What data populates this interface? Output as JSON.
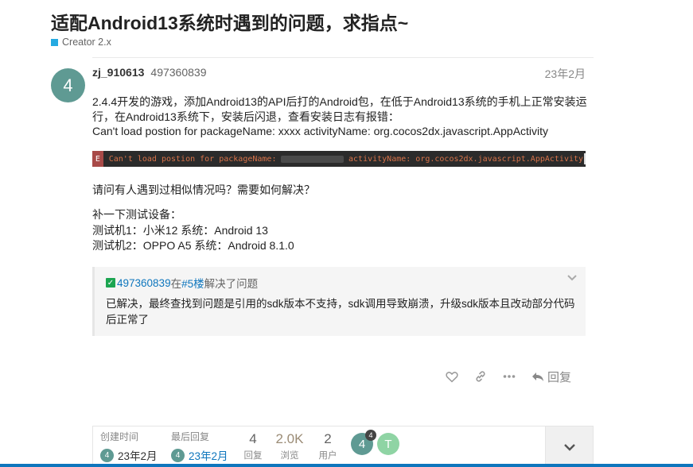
{
  "topic": {
    "title": "适配Android13系统时遇到的问题，求指点~",
    "category": "Creator 2.x",
    "category_color": "#25aae1"
  },
  "post": {
    "avatar_letter": "4",
    "avatar_color": "#5f9a93",
    "username": "zj_910613",
    "user_id": "497360839",
    "date": "23年2月",
    "para1_line1": "2.4.4开发的游戏，添加Android13的API后打的Android包，在低于Android13系统的手机上正常安装运",
    "para1_line2": "行，在Android13系统下，安装后闪退，查看安装日志有报错：",
    "para1_line3": "Can't load postion for packageName: xxxx activityName: org.cocos2dx.javascript.AppActivity",
    "code_badge": "E",
    "code_part1": "Can't load postion for packageName:",
    "code_part2": "activityName: org.cocos2dx.javascript.AppActivity",
    "question": "请问有人遇到过相似情况吗？需要如何解决？",
    "note_title": "补一下测试设备：",
    "note_line1": "测试机1：小米12 系统：Android 13",
    "note_line2": "测试机2：OPPO A5 系统：Android 8.1.0"
  },
  "solution": {
    "user": "497360839",
    "at": "在",
    "floor": "#5楼",
    "suffix": "解决了问题",
    "text_line1": "已解决，最终查找到问题是引用的sdk版本不支持，sdk调用导致崩溃，升级sdk版本且改动部分代码",
    "text_line2": "后正常了"
  },
  "actions": {
    "like_icon": "heart-icon",
    "share_icon": "link-icon",
    "more_icon": "ellipsis-icon",
    "reply_label": "回复"
  },
  "topic_map": {
    "created_label": "创建时间",
    "created_avatar": "4",
    "created_date": "23年2月",
    "last_reply_label": "最后回复",
    "last_reply_avatar": "4",
    "last_reply_date": "23年2月",
    "replies_num": "4",
    "replies_label": "回复",
    "views_num": "2.0K",
    "views_label": "浏览",
    "users_num": "2",
    "users_label": "用户",
    "participants": [
      {
        "letter": "4",
        "count": "4",
        "color": "#5f9a93"
      },
      {
        "letter": "T",
        "count": "",
        "color": "#8fd4a4"
      }
    ]
  }
}
